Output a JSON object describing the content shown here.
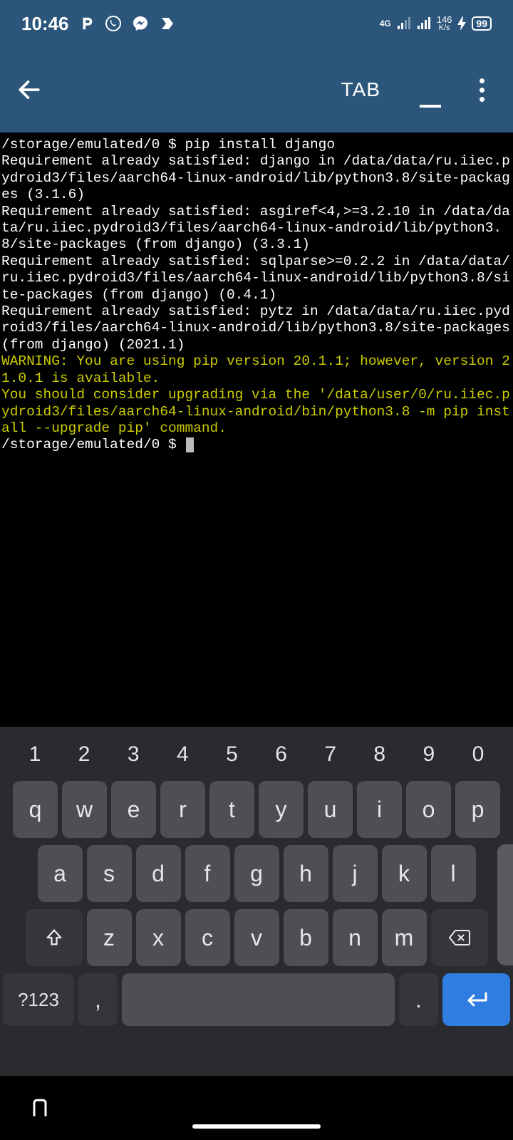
{
  "status": {
    "time": "10:46",
    "network_badge": "4G",
    "net_speed_value": "146",
    "net_speed_unit": "K/s",
    "battery": "99"
  },
  "appbar": {
    "tab_label": "TAB"
  },
  "terminal": {
    "line1": "/storage/emulated/0 $ pip install django",
    "line2": "Requirement already satisfied: django in /data/data/ru.iiec.pydroid3/files/aarch64-linux-android/lib/python3.8/site-packages (3.1.6)",
    "line3": "Requirement already satisfied: asgiref<4,>=3.2.10 in /data/data/ru.iiec.pydroid3/files/aarch64-linux-android/lib/python3.8/site-packages (from django) (3.3.1)",
    "line4": "Requirement already satisfied: sqlparse>=0.2.2 in /data/data/ru.iiec.pydroid3/files/aarch64-linux-android/lib/python3.8/site-packages (from django) (0.4.1)",
    "line5": "Requirement already satisfied: pytz in /data/data/ru.iiec.pydroid3/files/aarch64-linux-android/lib/python3.8/site-packages (from django) (2021.1)",
    "warn1": "WARNING: You are using pip version 20.1.1; however, version 21.0.1 is available.",
    "warn2": "You should consider upgrading via the '/data/user/0/ru.iiec.pydroid3/files/aarch64-linux-android/bin/python3.8 -m pip install --upgrade pip' command.",
    "prompt": "/storage/emulated/0 $ "
  },
  "keyboard": {
    "nums": [
      "1",
      "2",
      "3",
      "4",
      "5",
      "6",
      "7",
      "8",
      "9",
      "0"
    ],
    "row1": [
      "q",
      "w",
      "e",
      "r",
      "t",
      "y",
      "u",
      "i",
      "o",
      "p"
    ],
    "row2": [
      "a",
      "s",
      "d",
      "f",
      "g",
      "h",
      "j",
      "k",
      "l"
    ],
    "row3": [
      "z",
      "x",
      "c",
      "v",
      "b",
      "n",
      "m"
    ],
    "sym": "?123",
    "comma": ",",
    "period": "."
  }
}
